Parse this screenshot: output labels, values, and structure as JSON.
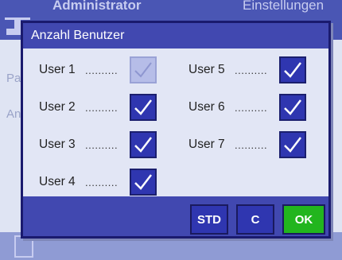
{
  "background": {
    "title": "Administrator",
    "title_right": "Einstellungen",
    "rows": [
      "Pa",
      "An"
    ]
  },
  "dialog": {
    "title": "Anzahl Benutzer",
    "dots": "..........",
    "users": [
      {
        "label": "User 1",
        "checked": true,
        "disabled": true
      },
      {
        "label": "User 2",
        "checked": true,
        "disabled": false
      },
      {
        "label": "User 3",
        "checked": true,
        "disabled": false
      },
      {
        "label": "User 4",
        "checked": true,
        "disabled": false
      },
      {
        "label": "User 5",
        "checked": true,
        "disabled": false
      },
      {
        "label": "User 6",
        "checked": true,
        "disabled": false
      },
      {
        "label": "User 7",
        "checked": true,
        "disabled": false
      }
    ],
    "buttons": {
      "std": "STD",
      "c": "C",
      "ok": "OK"
    }
  },
  "colors": {
    "accent": "#2f36b0",
    "title_bar": "#4148b0",
    "ok": "#22b51e"
  }
}
